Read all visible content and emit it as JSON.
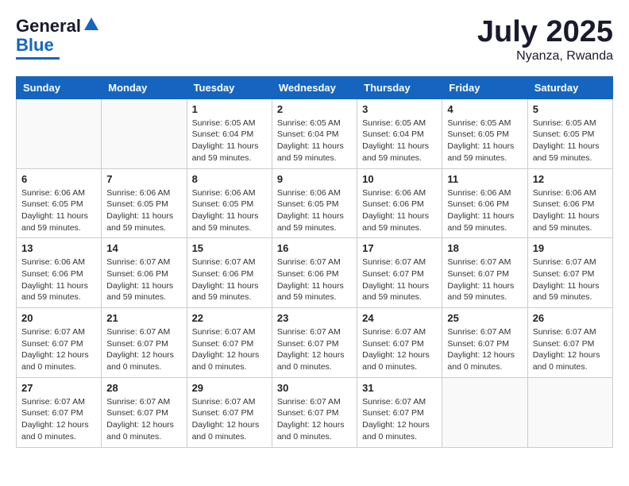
{
  "header": {
    "logo_line1": "General",
    "logo_line2": "Blue",
    "month_year": "July 2025",
    "location": "Nyanza, Rwanda"
  },
  "weekdays": [
    "Sunday",
    "Monday",
    "Tuesday",
    "Wednesday",
    "Thursday",
    "Friday",
    "Saturday"
  ],
  "weeks": [
    [
      {
        "day": "",
        "info": ""
      },
      {
        "day": "",
        "info": ""
      },
      {
        "day": "1",
        "info": "Sunrise: 6:05 AM\nSunset: 6:04 PM\nDaylight: 11 hours and 59 minutes."
      },
      {
        "day": "2",
        "info": "Sunrise: 6:05 AM\nSunset: 6:04 PM\nDaylight: 11 hours and 59 minutes."
      },
      {
        "day": "3",
        "info": "Sunrise: 6:05 AM\nSunset: 6:04 PM\nDaylight: 11 hours and 59 minutes."
      },
      {
        "day": "4",
        "info": "Sunrise: 6:05 AM\nSunset: 6:05 PM\nDaylight: 11 hours and 59 minutes."
      },
      {
        "day": "5",
        "info": "Sunrise: 6:05 AM\nSunset: 6:05 PM\nDaylight: 11 hours and 59 minutes."
      }
    ],
    [
      {
        "day": "6",
        "info": "Sunrise: 6:06 AM\nSunset: 6:05 PM\nDaylight: 11 hours and 59 minutes."
      },
      {
        "day": "7",
        "info": "Sunrise: 6:06 AM\nSunset: 6:05 PM\nDaylight: 11 hours and 59 minutes."
      },
      {
        "day": "8",
        "info": "Sunrise: 6:06 AM\nSunset: 6:05 PM\nDaylight: 11 hours and 59 minutes."
      },
      {
        "day": "9",
        "info": "Sunrise: 6:06 AM\nSunset: 6:05 PM\nDaylight: 11 hours and 59 minutes."
      },
      {
        "day": "10",
        "info": "Sunrise: 6:06 AM\nSunset: 6:06 PM\nDaylight: 11 hours and 59 minutes."
      },
      {
        "day": "11",
        "info": "Sunrise: 6:06 AM\nSunset: 6:06 PM\nDaylight: 11 hours and 59 minutes."
      },
      {
        "day": "12",
        "info": "Sunrise: 6:06 AM\nSunset: 6:06 PM\nDaylight: 11 hours and 59 minutes."
      }
    ],
    [
      {
        "day": "13",
        "info": "Sunrise: 6:06 AM\nSunset: 6:06 PM\nDaylight: 11 hours and 59 minutes."
      },
      {
        "day": "14",
        "info": "Sunrise: 6:07 AM\nSunset: 6:06 PM\nDaylight: 11 hours and 59 minutes."
      },
      {
        "day": "15",
        "info": "Sunrise: 6:07 AM\nSunset: 6:06 PM\nDaylight: 11 hours and 59 minutes."
      },
      {
        "day": "16",
        "info": "Sunrise: 6:07 AM\nSunset: 6:06 PM\nDaylight: 11 hours and 59 minutes."
      },
      {
        "day": "17",
        "info": "Sunrise: 6:07 AM\nSunset: 6:07 PM\nDaylight: 11 hours and 59 minutes."
      },
      {
        "day": "18",
        "info": "Sunrise: 6:07 AM\nSunset: 6:07 PM\nDaylight: 11 hours and 59 minutes."
      },
      {
        "day": "19",
        "info": "Sunrise: 6:07 AM\nSunset: 6:07 PM\nDaylight: 11 hours and 59 minutes."
      }
    ],
    [
      {
        "day": "20",
        "info": "Sunrise: 6:07 AM\nSunset: 6:07 PM\nDaylight: 12 hours and 0 minutes."
      },
      {
        "day": "21",
        "info": "Sunrise: 6:07 AM\nSunset: 6:07 PM\nDaylight: 12 hours and 0 minutes."
      },
      {
        "day": "22",
        "info": "Sunrise: 6:07 AM\nSunset: 6:07 PM\nDaylight: 12 hours and 0 minutes."
      },
      {
        "day": "23",
        "info": "Sunrise: 6:07 AM\nSunset: 6:07 PM\nDaylight: 12 hours and 0 minutes."
      },
      {
        "day": "24",
        "info": "Sunrise: 6:07 AM\nSunset: 6:07 PM\nDaylight: 12 hours and 0 minutes."
      },
      {
        "day": "25",
        "info": "Sunrise: 6:07 AM\nSunset: 6:07 PM\nDaylight: 12 hours and 0 minutes."
      },
      {
        "day": "26",
        "info": "Sunrise: 6:07 AM\nSunset: 6:07 PM\nDaylight: 12 hours and 0 minutes."
      }
    ],
    [
      {
        "day": "27",
        "info": "Sunrise: 6:07 AM\nSunset: 6:07 PM\nDaylight: 12 hours and 0 minutes."
      },
      {
        "day": "28",
        "info": "Sunrise: 6:07 AM\nSunset: 6:07 PM\nDaylight: 12 hours and 0 minutes."
      },
      {
        "day": "29",
        "info": "Sunrise: 6:07 AM\nSunset: 6:07 PM\nDaylight: 12 hours and 0 minutes."
      },
      {
        "day": "30",
        "info": "Sunrise: 6:07 AM\nSunset: 6:07 PM\nDaylight: 12 hours and 0 minutes."
      },
      {
        "day": "31",
        "info": "Sunrise: 6:07 AM\nSunset: 6:07 PM\nDaylight: 12 hours and 0 minutes."
      },
      {
        "day": "",
        "info": ""
      },
      {
        "day": "",
        "info": ""
      }
    ]
  ]
}
